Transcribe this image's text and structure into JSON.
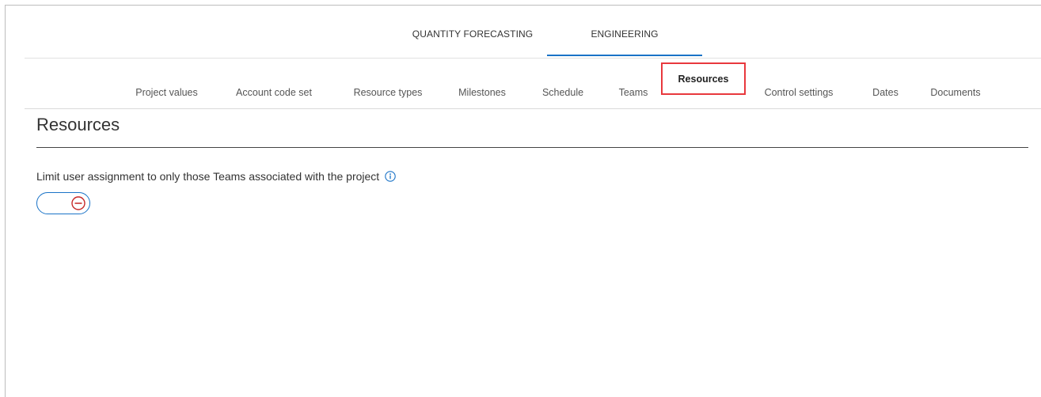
{
  "top_tabs": [
    {
      "label": "QUANTITY FORECASTING",
      "active": false
    },
    {
      "label": "ENGINEERING",
      "active": true
    }
  ],
  "sub_tabs": [
    {
      "label": "Project values"
    },
    {
      "label": "Account code set"
    },
    {
      "label": "Resource types"
    },
    {
      "label": "Milestones"
    },
    {
      "label": "Schedule"
    },
    {
      "label": "Teams"
    },
    {
      "label": "Resources",
      "active": true
    },
    {
      "label": "Control settings"
    },
    {
      "label": "Dates"
    },
    {
      "label": "Documents"
    }
  ],
  "section": {
    "title": "Resources",
    "setting_label": "Limit user assignment to only those Teams associated with the project",
    "info_icon": "info-circle-icon",
    "toggle_state": "off",
    "toggle_icon": "minus-circle-icon"
  },
  "colors": {
    "accent": "#1a73c7",
    "highlight": "#e8383d",
    "toggle_off_icon": "#c62828"
  }
}
